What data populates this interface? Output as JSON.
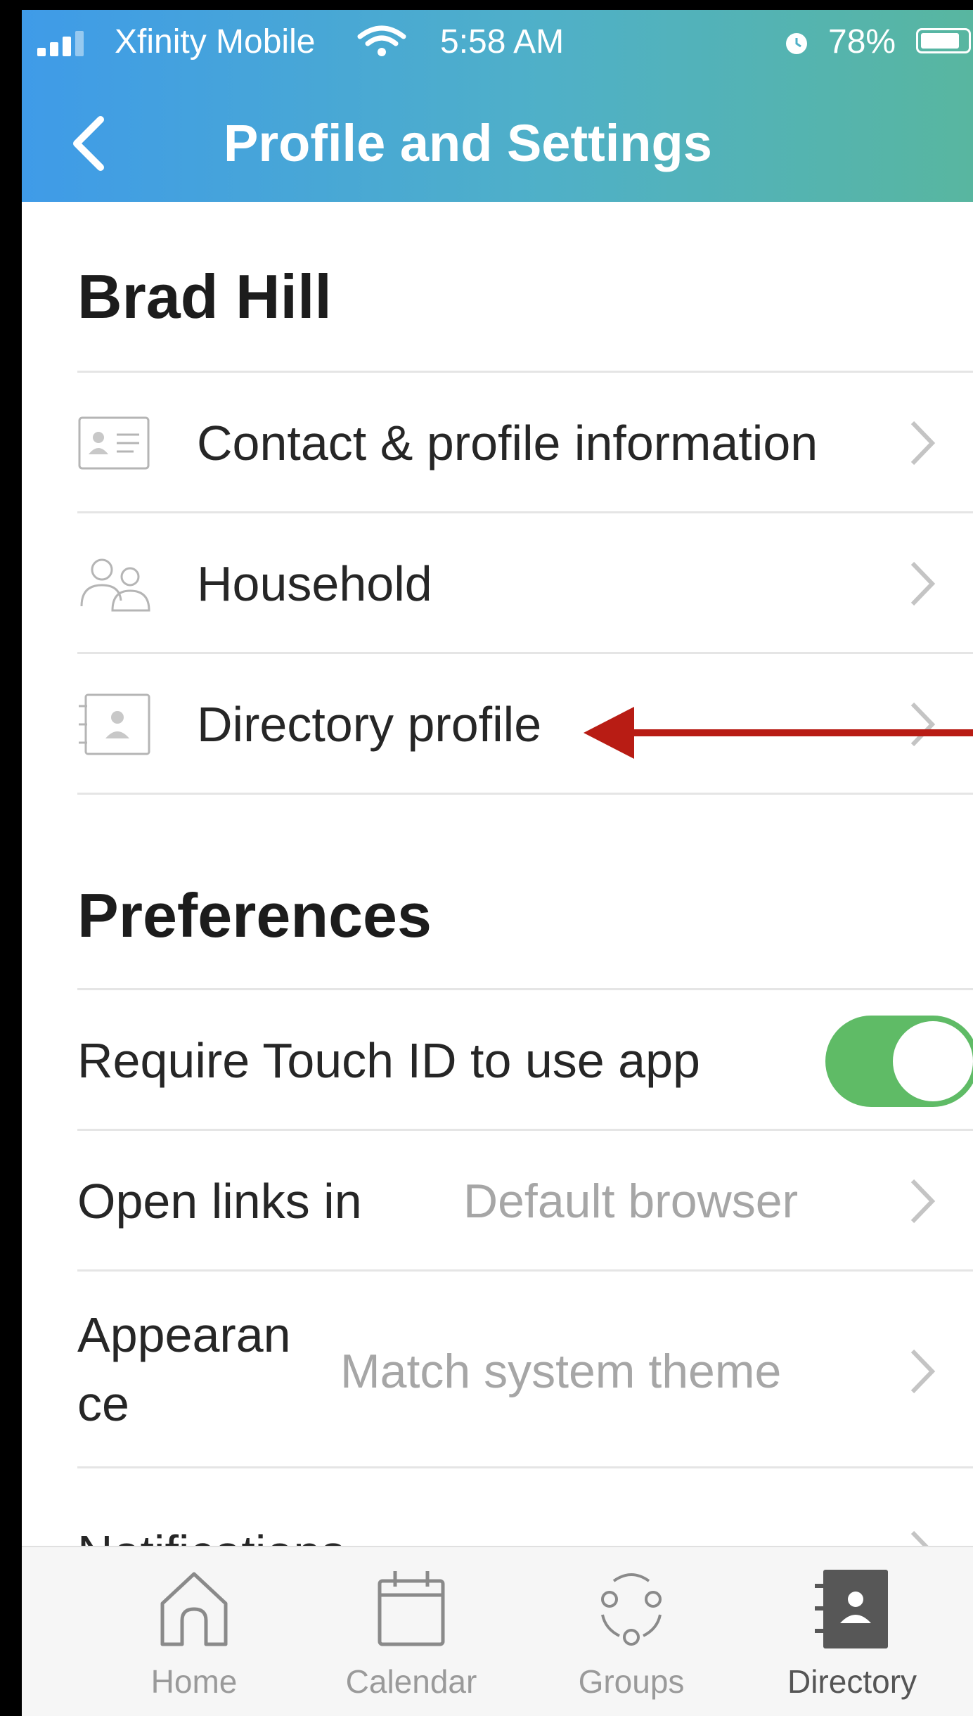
{
  "status_bar": {
    "carrier": "Xfinity Mobile",
    "time": "5:58 AM",
    "battery": "78%"
  },
  "header": {
    "title": "Profile and Settings"
  },
  "profile": {
    "name": "Brad Hill",
    "items": [
      {
        "label": "Contact & profile information",
        "icon": "contact-card-icon"
      },
      {
        "label": "Household",
        "icon": "people-icon"
      },
      {
        "label": "Directory profile",
        "icon": "directory-book-icon"
      }
    ]
  },
  "preferences": {
    "title": "Preferences",
    "touch_id": {
      "label": "Require Touch ID to use app",
      "enabled": true,
      "color": "#5fbb66"
    },
    "links": {
      "label": "Open links in",
      "value": "Default browser"
    },
    "appearance": {
      "label_line1": "Appearan",
      "label_line2": "ce",
      "value": "Match system theme"
    },
    "notifications": {
      "label": "Notifications"
    }
  },
  "annotation": {
    "arrow_color": "#b81c14"
  },
  "tabs": [
    {
      "label": "Home",
      "icon": "home-icon"
    },
    {
      "label": "Calendar",
      "icon": "calendar-icon"
    },
    {
      "label": "Groups",
      "icon": "groups-icon"
    },
    {
      "label": "Directory",
      "icon": "directory-icon",
      "active": true
    }
  ]
}
